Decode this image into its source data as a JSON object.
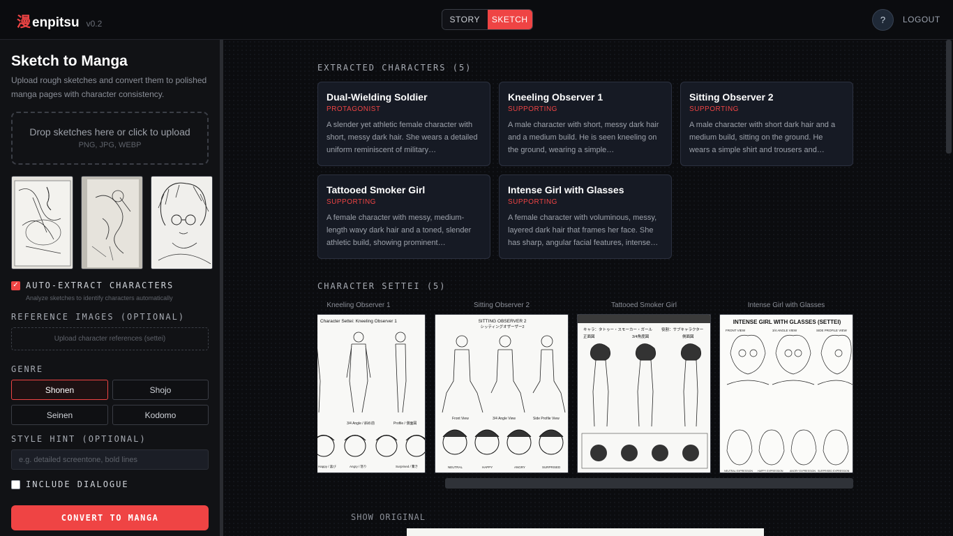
{
  "header": {
    "logo_kanji": "漫",
    "logo_text": "enpitsu",
    "version": "v0.2",
    "modes": [
      "STORY",
      "SKETCH"
    ],
    "active_mode": "SKETCH",
    "help_label": "?",
    "logout_label": "LOGOUT"
  },
  "sidebar": {
    "title": "Sketch to Manga",
    "description": "Upload rough sketches and convert them to polished manga pages with character consistency.",
    "dropzone_main": "Drop sketches here or click to upload",
    "dropzone_sub": "PNG, JPG, WEBP",
    "auto_extract_label": "AUTO-EXTRACT CHARACTERS",
    "auto_extract_checked": true,
    "auto_extract_hint": "Analyze sketches to identify characters automatically",
    "reference_label": "REFERENCE IMAGES (OPTIONAL)",
    "reference_upload": "Upload character references (settei)",
    "genre_label": "GENRE",
    "genres": [
      "Shonen",
      "Shojo",
      "Seinen",
      "Kodomo"
    ],
    "active_genre": "Shonen",
    "style_label": "STYLE HINT (OPTIONAL)",
    "style_placeholder": "e.g. detailed screentone, bold lines",
    "dialogue_label": "INCLUDE DIALOGUE",
    "dialogue_checked": false,
    "convert_label": "CONVERT TO MANGA"
  },
  "main": {
    "extracted_label": "EXTRACTED CHARACTERS (5)",
    "characters": [
      {
        "name": "Dual-Wielding Soldier",
        "role": "PROTAGONIST",
        "desc": "A slender yet athletic female character with short, messy dark hair. She wears a detailed uniform reminiscent of military…"
      },
      {
        "name": "Kneeling Observer 1",
        "role": "SUPPORTING",
        "desc": "A male character with short, messy dark hair and a medium build. He is seen kneeling on the ground, wearing a simple…"
      },
      {
        "name": "Sitting Observer 2",
        "role": "SUPPORTING",
        "desc": "A male character with short dark hair and a medium build, sitting on the ground. He wears a simple shirt and trousers and…"
      },
      {
        "name": "Tattooed Smoker Girl",
        "role": "SUPPORTING",
        "desc": "A female character with messy, medium-length wavy dark hair and a toned, slender athletic build, showing prominent…"
      },
      {
        "name": "Intense Girl with Glasses",
        "role": "SUPPORTING",
        "desc": "A female character with voluminous, messy, layered dark hair that frames her face. She has sharp, angular facial features, intense…"
      }
    ],
    "settei_label": "CHARACTER SETTEI (5)",
    "settei": [
      {
        "caption": "Kneeling Observer 1",
        "sheet_title": "Character Settei: Kneeling Observer 1",
        "views": [
          "3/4 Angle / 斜め前",
          "Profile / 側面図"
        ],
        "expressions": [
          "Happy / 喜び",
          "Angry / 怒り",
          "Surprised / 驚き"
        ]
      },
      {
        "caption": "Sitting Observer 2",
        "sheet_title": "SITTING OBSERVER 2",
        "sheet_sub": "シッティングオザーザー2",
        "views": [
          "Front View",
          "3/4 Angle View",
          "Side Profile View"
        ],
        "expressions": [
          "NEUTRAL",
          "HAPPY",
          "ANGRY",
          "SURPRISED"
        ]
      },
      {
        "caption": "Tattooed Smoker Girl",
        "sheet_title": "キャラ：タトゥー・スモーカー・ガール",
        "sheet_role": "役割：サブキャラクター",
        "views": [
          "正面図",
          "3/4角度図",
          "側面図"
        ]
      },
      {
        "caption": "Intense Girl with Glasses",
        "sheet_title": "INTENSE GIRL WITH GLASSES (SETTEI)",
        "views": [
          "FRONT VIEW",
          "3/4 ANGLE VIEW",
          "SIDE PROFILE VIEW"
        ],
        "expressions": [
          "NEUTRAL EXPRESSION",
          "HAPPY EXPRESSION",
          "ANGRY EXPRESSION",
          "SURPRISED EXPRESSION"
        ]
      }
    ],
    "show_original_label": "SHOW ORIGINAL"
  },
  "colors": {
    "accent": "#ef4444",
    "background": "#0b0c0f",
    "card": "#161a24"
  }
}
